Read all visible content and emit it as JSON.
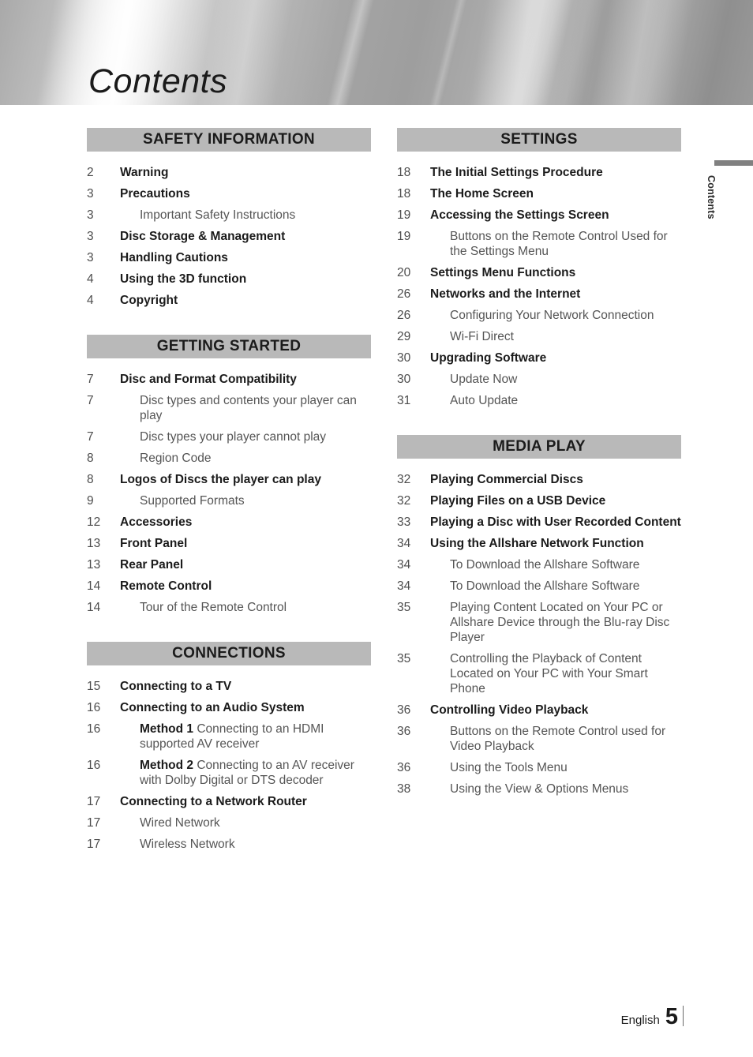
{
  "banner": {
    "title": "Contents"
  },
  "side_tab": {
    "label": "Contents"
  },
  "footer": {
    "language": "English",
    "page_number": "5"
  },
  "columns": [
    {
      "id": "left",
      "sections": [
        {
          "heading": "SAFETY INFORMATION",
          "entries": [
            {
              "page": "2",
              "level": 1,
              "text": "Warning"
            },
            {
              "page": "3",
              "level": 1,
              "text": "Precautions"
            },
            {
              "page": "3",
              "level": 2,
              "text": "Important Safety Instructions"
            },
            {
              "page": "3",
              "level": 1,
              "text": "Disc Storage & Management"
            },
            {
              "page": "3",
              "level": 1,
              "text": "Handling Cautions"
            },
            {
              "page": "4",
              "level": 1,
              "text": "Using the 3D function"
            },
            {
              "page": "4",
              "level": 1,
              "text": "Copyright"
            }
          ]
        },
        {
          "heading": "GETTING STARTED",
          "entries": [
            {
              "page": "7",
              "level": 1,
              "text": "Disc and Format Compatibility"
            },
            {
              "page": "7",
              "level": 2,
              "text": "Disc types and contents your player can play"
            },
            {
              "page": "7",
              "level": 2,
              "text": "Disc types your player cannot play"
            },
            {
              "page": "8",
              "level": 2,
              "text": "Region Code"
            },
            {
              "page": "8",
              "level": 1,
              "text": "Logos of Discs the player can play"
            },
            {
              "page": "9",
              "level": 2,
              "text": "Supported Formats"
            },
            {
              "page": "12",
              "level": 1,
              "text": "Accessories"
            },
            {
              "page": "13",
              "level": 1,
              "text": "Front Panel"
            },
            {
              "page": "13",
              "level": 1,
              "text": "Rear Panel"
            },
            {
              "page": "14",
              "level": 1,
              "text": "Remote Control"
            },
            {
              "page": "14",
              "level": 2,
              "text": "Tour of the Remote Control"
            }
          ]
        },
        {
          "heading": "CONNECTIONS",
          "entries": [
            {
              "page": "15",
              "level": 1,
              "text": "Connecting to a TV"
            },
            {
              "page": "16",
              "level": 1,
              "text": "Connecting to an Audio System"
            },
            {
              "page": "16",
              "level": 2,
              "lead": "Method 1",
              "text": " Connecting to an HDMI supported AV receiver"
            },
            {
              "page": "16",
              "level": 2,
              "lead": "Method 2",
              "text": " Connecting to an AV receiver with Dolby Digital or DTS decoder"
            },
            {
              "page": "17",
              "level": 1,
              "text": "Connecting to a Network Router"
            },
            {
              "page": "17",
              "level": 2,
              "text": "Wired Network"
            },
            {
              "page": "17",
              "level": 2,
              "text": "Wireless Network"
            }
          ]
        }
      ]
    },
    {
      "id": "right",
      "sections": [
        {
          "heading": "SETTINGS",
          "entries": [
            {
              "page": "18",
              "level": 1,
              "text": "The Initial Settings Procedure"
            },
            {
              "page": "18",
              "level": 1,
              "text": "The Home Screen"
            },
            {
              "page": "19",
              "level": 1,
              "text": "Accessing the Settings Screen"
            },
            {
              "page": "19",
              "level": 2,
              "text": "Buttons on the Remote Control Used for the Settings Menu"
            },
            {
              "page": "20",
              "level": 1,
              "text": "Settings Menu Functions"
            },
            {
              "page": "26",
              "level": 1,
              "text": "Networks and the Internet"
            },
            {
              "page": "26",
              "level": 2,
              "text": "Configuring Your Network Connection"
            },
            {
              "page": "29",
              "level": 2,
              "text": "Wi-Fi Direct"
            },
            {
              "page": "30",
              "level": 1,
              "text": "Upgrading Software"
            },
            {
              "page": "30",
              "level": 2,
              "text": "Update Now"
            },
            {
              "page": "31",
              "level": 2,
              "text": "Auto Update"
            }
          ]
        },
        {
          "heading": "MEDIA PLAY",
          "entries": [
            {
              "page": "32",
              "level": 1,
              "text": "Playing Commercial Discs"
            },
            {
              "page": "32",
              "level": 1,
              "text": "Playing Files on a USB Device"
            },
            {
              "page": "33",
              "level": 1,
              "text": "Playing a Disc with User Recorded Content"
            },
            {
              "page": "34",
              "level": 1,
              "text": "Using the Allshare Network Function"
            },
            {
              "page": "34",
              "level": 2,
              "text": "To Download the Allshare Software"
            },
            {
              "page": "34",
              "level": 2,
              "text": "To Download the Allshare Software"
            },
            {
              "page": "35",
              "level": 2,
              "text": "Playing Content Located on Your PC or Allshare Device through the Blu-ray Disc Player"
            },
            {
              "page": "35",
              "level": 2,
              "text": "Controlling the Playback of Content Located on Your PC with Your Smart Phone"
            },
            {
              "page": "36",
              "level": 1,
              "text": "Controlling Video Playback"
            },
            {
              "page": "36",
              "level": 2,
              "text": "Buttons on the Remote Control used for Video Playback"
            },
            {
              "page": "36",
              "level": 2,
              "text": "Using the Tools Menu"
            },
            {
              "page": "38",
              "level": 2,
              "text": "Using the View & Options Menus"
            }
          ]
        }
      ]
    }
  ]
}
